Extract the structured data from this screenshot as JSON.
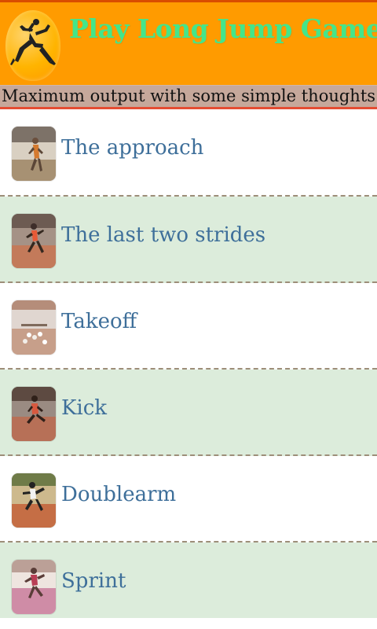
{
  "header": {
    "title": "Play Long Jump Games",
    "logo_icon": "long-jumper-icon",
    "colors": {
      "header_bg": "#ff9b00",
      "title_color": "#44e58b",
      "tagline_bg": "#c6a89b",
      "tagline_border": "#e44d33",
      "item_label": "#3e6f9a",
      "alt_row_bg": "#dcecdb"
    }
  },
  "tagline": {
    "text": "Maximum output with some simple thoughts..."
  },
  "items": [
    {
      "label": "The approach",
      "icon": "approach-photo-icon"
    },
    {
      "label": "The last two strides",
      "icon": "last-strides-photo-icon"
    },
    {
      "label": "Takeoff",
      "icon": "takeoff-photo-icon"
    },
    {
      "label": "Kick",
      "icon": "kick-photo-icon"
    },
    {
      "label": "Doublearm",
      "icon": "doublearm-photo-icon"
    },
    {
      "label": "Sprint",
      "icon": "sprint-photo-icon"
    }
  ]
}
